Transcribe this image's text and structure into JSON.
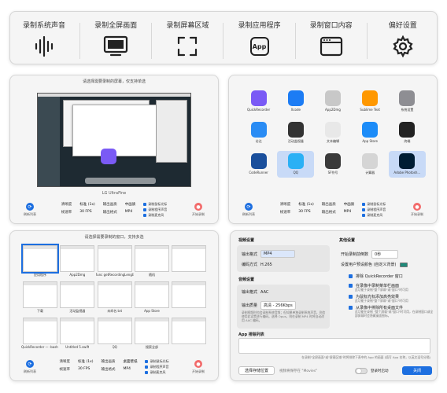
{
  "toolbar": {
    "items": [
      {
        "label": "录制系统声音",
        "icon": "waveform-icon"
      },
      {
        "label": "录制全屏画面",
        "icon": "monitor-icon"
      },
      {
        "label": "录制屏幕区域",
        "icon": "crop-region-icon"
      },
      {
        "label": "录制应用程序",
        "icon": "app-icon",
        "icon_text": "App"
      },
      {
        "label": "录制窗口内容",
        "icon": "window-icon"
      },
      {
        "label": "偏好设置",
        "icon": "gear-icon"
      }
    ]
  },
  "screen_panel": {
    "title": "请选择需要录制的屏幕，仅支持单选",
    "caption": "LG UltraFine",
    "bottom": {
      "refresh": "刷新列表",
      "start": "开始录制",
      "labels_a": [
        "清晰度",
        "帧速率"
      ],
      "values_a": [
        "标准 (1x)",
        "30 FPS"
      ],
      "labels_b": [
        "输出画质",
        "输出格式"
      ],
      "values_b": [
        "中画质",
        "MP4"
      ],
      "checks": [
        "录制鼠标光标",
        "录制程序声音",
        "录制麦克风"
      ]
    }
  },
  "app_panel": {
    "apps": [
      {
        "name": "QuickRecorder",
        "color": "#7a5af5",
        "selected": false
      },
      {
        "name": "Xcode",
        "color": "#1c7cf4",
        "selected": false
      },
      {
        "name": "App2Dmg",
        "color": "#c8c8c8",
        "selected": false
      },
      {
        "name": "Sublime Text",
        "color": "#ff9800",
        "selected": false
      },
      {
        "name": "系统设置",
        "color": "#8e8e93",
        "selected": false
      },
      {
        "name": "访达",
        "color": "#2a8cf4",
        "selected": false
      },
      {
        "name": "活动监视器",
        "color": "#333333",
        "selected": false
      },
      {
        "name": "文本编辑",
        "color": "#e8e8e8",
        "selected": false
      },
      {
        "name": "App Store",
        "color": "#1c8cf8",
        "selected": false
      },
      {
        "name": "终端",
        "color": "#222222",
        "selected": false
      },
      {
        "name": "CodeRunner",
        "color": "#1a4f9c",
        "selected": false
      },
      {
        "name": "QQ",
        "color": "#2ab0f5",
        "selected": true
      },
      {
        "name": "SF符号",
        "color": "#3a3a3a",
        "selected": false
      },
      {
        "name": "计算器",
        "color": "#d5d5d5",
        "selected": false
      },
      {
        "name": "Adobe Photosh…",
        "color": "#001d34",
        "selected": true
      }
    ],
    "bottom": {
      "refresh": "刷新列表",
      "start": "开始录制",
      "labels_a": [
        "清晰度",
        "帧速率"
      ],
      "values_a": [
        "标准 (1x)",
        "30 FPS"
      ],
      "labels_b": [
        "输出画质",
        "输出格式"
      ],
      "values_b": [
        "中画质",
        "MP4"
      ],
      "checks": [
        "录制鼠标光标",
        "录制程序声音",
        "录制麦克风"
      ]
    }
  },
  "window_panel": {
    "title": "请选择需要录制的窗口，支持多选",
    "windows": [
      {
        "name": "应用程序",
        "selected": true
      },
      {
        "name": "App2Dmg",
        "selected": false
      },
      {
        "name": "func getRecordingLength(…",
        "selected": false
      },
      {
        "name": "随机",
        "selected": false
      },
      {
        "name": "",
        "selected": false
      },
      {
        "name": "下载",
        "selected": false
      },
      {
        "name": "活动监视器",
        "selected": false
      },
      {
        "name": "未命名.txt",
        "selected": false
      },
      {
        "name": "App Store",
        "selected": false
      },
      {
        "name": "",
        "selected": false
      },
      {
        "name": "QuickRecorder — -bash —…",
        "selected": false
      },
      {
        "name": "Untitled 5.swift",
        "selected": false
      },
      {
        "name": "QQ",
        "selected": false
      },
      {
        "name": "搜索全部",
        "selected": false
      },
      {
        "name": "",
        "selected": false
      }
    ],
    "bottom": {
      "refresh": "刷新列表",
      "start": "开始录制",
      "labels_a": [
        "清晰度",
        "帧速率"
      ],
      "values_a": [
        "标准 (1x)",
        "30 FPS"
      ],
      "labels_b": [
        "输出画质",
        "输出格式"
      ],
      "values_b": [
        "桌面壁纸",
        "MP4"
      ],
      "checks": [
        "录制鼠标光标",
        "录制程序声音",
        "录制麦克风"
      ]
    }
  },
  "settings_panel": {
    "video_section": "视频设置",
    "video_rows": [
      {
        "label": "输出格式",
        "value": "MP4"
      },
      {
        "label": "编码方式",
        "value": "H.265"
      }
    ],
    "audio_section": "音频设置",
    "audio_rows": [
      {
        "label": "输出格式",
        "value": "AAC"
      },
      {
        "label": "输出质量",
        "value": "高清 - 256Kbps"
      }
    ],
    "audio_hint": "录制视频时也会录制系统音频；但如果单独录制系统声音，则会使用此设置进行编码。选择 Opus，则在录制 MP4 时将自动改用 AAC 编码。",
    "other_section": "其他设置",
    "countdown_label": "开始录制前倒数",
    "countdown_value": "0秒",
    "bgcolor_label": "设置用户预设颜色 (自定义背景)",
    "options": [
      {
        "label": "排除 QuickRecorder 窗口",
        "hint": ""
      },
      {
        "label": "在录像中录制菜单栏画面",
        "hint": "此功能于录制\"整个屏幕\"或\"窗口\"时可用"
      },
      {
        "label": "为鼠标光标添加高亮效果",
        "hint": "此功能于录制\"整个屏幕\"或\"窗口\"时可用"
      },
      {
        "label": "从录像中排除所有桌面文件",
        "hint": "此功能在录制 \"整个屏幕\"或\"窗口\"时可用，在录制窗口或全部屏幕时会隐藏桌面图标。"
      }
    ],
    "exclude_section": "App 排除列表",
    "exclude_hint": "在录制\"全屏画面\"或\"屏幕区域\"时将排除下表中的 App 的画面 (填写 App 名称，以英文逗号分隔)",
    "choose_button": "选择存储位置",
    "save_path": "视频将保存在 \"Movies\"",
    "login_label": "登录时启动",
    "close_button": "关闭"
  }
}
